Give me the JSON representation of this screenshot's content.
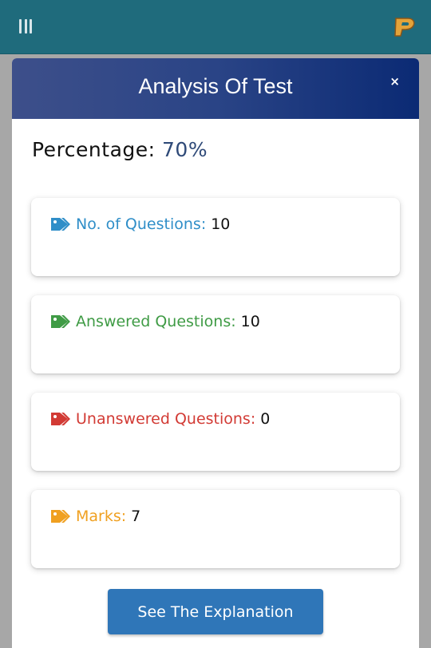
{
  "modal": {
    "title": "Analysis Of Test",
    "close_symbol": "×",
    "percentage_label": "Percentage:",
    "percentage_value": "70%"
  },
  "stats": [
    {
      "label": "No. of Questions:",
      "value": "10",
      "color": "#2f8ec8",
      "icon": "tag-icon"
    },
    {
      "label": "Answered Questions:",
      "value": "10",
      "color": "#3f9b45",
      "icon": "tag-icon"
    },
    {
      "label": "Unanswered Questions:",
      "value": "0",
      "color": "#d23a34",
      "icon": "tag-icon"
    },
    {
      "label": "Marks:",
      "value": "7",
      "color": "#f0a020",
      "icon": "tag-icon"
    }
  ],
  "actions": {
    "explanation_button": "See The Explanation"
  },
  "appbar": {
    "menu_icon": "hamburger-menu-icon",
    "logo_icon": "p-logo-icon"
  }
}
